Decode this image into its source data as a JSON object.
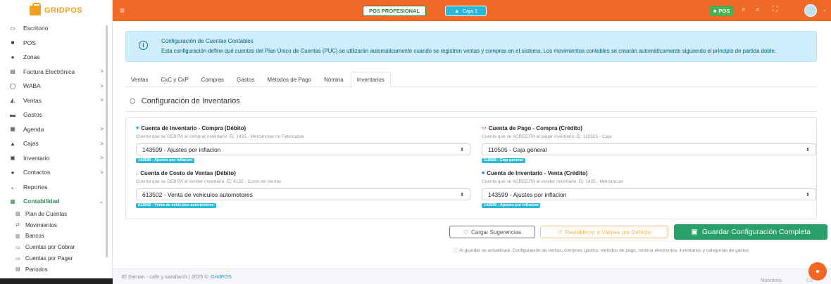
{
  "brand": {
    "name": "GRIDPOS"
  },
  "sidebar": {
    "items": [
      {
        "icon": "desktop-icon",
        "glyph": "▭",
        "label": "Escritorio",
        "chevron": ""
      },
      {
        "icon": "pos-icon",
        "glyph": "■",
        "label": "POS",
        "chevron": ""
      },
      {
        "icon": "map-pin-icon",
        "glyph": "●",
        "label": "Zonas",
        "chevron": ""
      },
      {
        "icon": "invoice-icon",
        "glyph": "▤",
        "label": "Factura Electrónica",
        "chevron": ">"
      },
      {
        "icon": "whatsapp-icon",
        "glyph": "◯",
        "label": "WABA",
        "chevron": ">"
      },
      {
        "icon": "sales-icon",
        "glyph": "◭",
        "label": "Ventas",
        "chevron": ">"
      },
      {
        "icon": "expenses-icon",
        "glyph": "▬",
        "label": "Gastos",
        "chevron": ""
      },
      {
        "icon": "calendar-icon",
        "glyph": "▦",
        "label": "Agenda",
        "chevron": ">"
      },
      {
        "icon": "cash-register-icon",
        "glyph": "▲",
        "label": "Cajas",
        "chevron": ">"
      },
      {
        "icon": "inventory-icon",
        "glyph": "▣",
        "label": "Inventario",
        "chevron": ">"
      },
      {
        "icon": "contacts-icon",
        "glyph": "●",
        "label": "Contactos",
        "chevron": ">"
      },
      {
        "icon": "reports-icon",
        "glyph": "⌞",
        "label": "Reportes",
        "chevron": ""
      },
      {
        "icon": "accounting-icon",
        "glyph": "▦",
        "label": "Contabilidad",
        "chevron": "⌄"
      }
    ],
    "subitems": [
      {
        "icon": "chart-of-accounts-icon",
        "glyph": "▧",
        "label": "Plan de Cuentas"
      },
      {
        "icon": "movements-icon",
        "glyph": "⇄",
        "label": "Movimientos"
      },
      {
        "icon": "bank-icon",
        "glyph": "▥",
        "label": "Bancos"
      },
      {
        "icon": "receivable-icon",
        "glyph": "▭",
        "label": "Cuentas por Cobrar"
      },
      {
        "icon": "payable-icon",
        "glyph": "▭",
        "label": "Cuentas por Pagar"
      },
      {
        "icon": "periods-icon",
        "glyph": "▤",
        "label": "Periodos"
      }
    ]
  },
  "header": {
    "pos_professional": "POS PROFESIONAL",
    "caja": "Caja 1",
    "pos_badge": "POS"
  },
  "info": {
    "title": "Configuración de Cuentas Contables",
    "text": "Esta configuración define qué cuentas del Plan Único de Cuentas (PUC) se utilizarán automáticamente cuando se registren ventas y compras en el sistema. Los movimientos contables se crearán automáticamente siguiendo el principio de partida doble."
  },
  "tabs": [
    "Ventas",
    "CxC y CxP",
    "Compras",
    "Gastos",
    "Métodos de Pago",
    "Nómina",
    "Inventarios"
  ],
  "section": {
    "title": "Configuración de Inventarios"
  },
  "fields": {
    "inv_compra": {
      "label": "Cuenta de Inventario - Compra (Débito)",
      "help": "Cuenta que se DEBITA al comprar inventario. Ej: 1435 - Mercancías no Fabricadas",
      "value": "143599 - Ajustes por inflacion",
      "badge": "143599 - Ajustes por inflacion"
    },
    "pago_compra": {
      "label": "Cuenta de Pago - Compra (Crédito)",
      "help": "Cuenta que se ACREDITA al pagar inventario. Ej: 110505 - Caja",
      "value": "110505 - Caja general",
      "badge": "110505 - Caja general"
    },
    "costo_ventas": {
      "label": "Cuenta de Costo de Ventas (Débito)",
      "help": "Cuenta que se DEBITA al vender inventario. Ej: 6135 - Costo de Ventas",
      "value": "613502 - Venta de vehiculos automotores",
      "badge": "613502 - Venta de vehiculos automotores"
    },
    "inv_venta": {
      "label": "Cuenta de Inventario - Venta (Crédito)",
      "help": "Cuenta que se ACREDITA al vender inventario. Ej: 1435 - Mercancías",
      "value": "143599 - Ajustes por inflacion",
      "badge": "143599 - Ajustes por inflacion"
    }
  },
  "actions": {
    "suggest": "Cargar Sugerencias",
    "reset": "Restablecer a Valores por Defecto",
    "save": "Guardar Configuración Completa",
    "note": "Al guardar se actualizará: Configuración de ventas, compras, gastos, métodos de pago, nómina electrónica, inventarios y categorías de gastos"
  },
  "footer": {
    "text": "El Saman - cafe y sandiwch | 2025 ©",
    "brand": "GridPOS",
    "right": "Nosotros",
    "right2": "Co"
  },
  "colors": {
    "header": "#ee6a26",
    "accent_green": "#28a06a",
    "info_bg": "#cdeefa",
    "badge": "#2bbbd8"
  }
}
